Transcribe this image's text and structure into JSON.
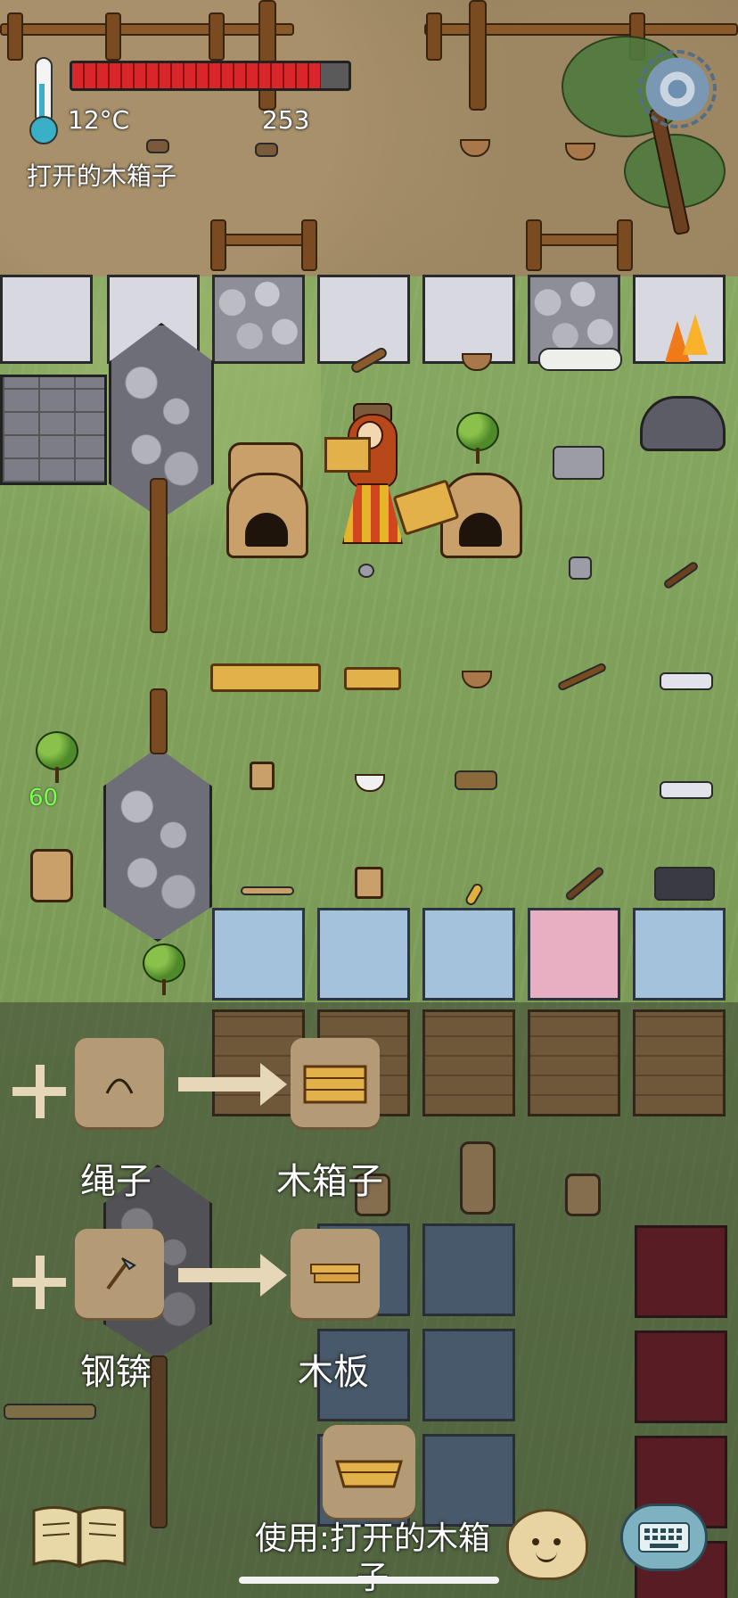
{
  "hud": {
    "temperature": "12°C",
    "food_count": "253",
    "food_level_fraction": 0.9,
    "holding_label": "打开的木箱子",
    "age": "60",
    "settings_icon": "gear-icon",
    "thermometer_icon": "thermometer-icon"
  },
  "recipes": [
    {
      "tool": "绳子",
      "tool_icon": "rope-icon",
      "result": "木箱子",
      "result_icon": "wooden-box-icon"
    },
    {
      "tool": "钢锛",
      "tool_icon": "steel-adze-icon",
      "result": "木板",
      "result_icon": "boards-icon"
    }
  ],
  "held": {
    "icon": "open-wooden-box-icon",
    "use_label": "使用:打开的木箱子"
  },
  "bottom": {
    "book_icon": "recipe-book-icon",
    "emote_icon": "emote-face-icon",
    "keyboard_icon": "keyboard-chat-icon"
  },
  "colors": {
    "food_red": "#d8262a",
    "age_green": "#7cff4a",
    "slot_tan": "#b49b76"
  }
}
